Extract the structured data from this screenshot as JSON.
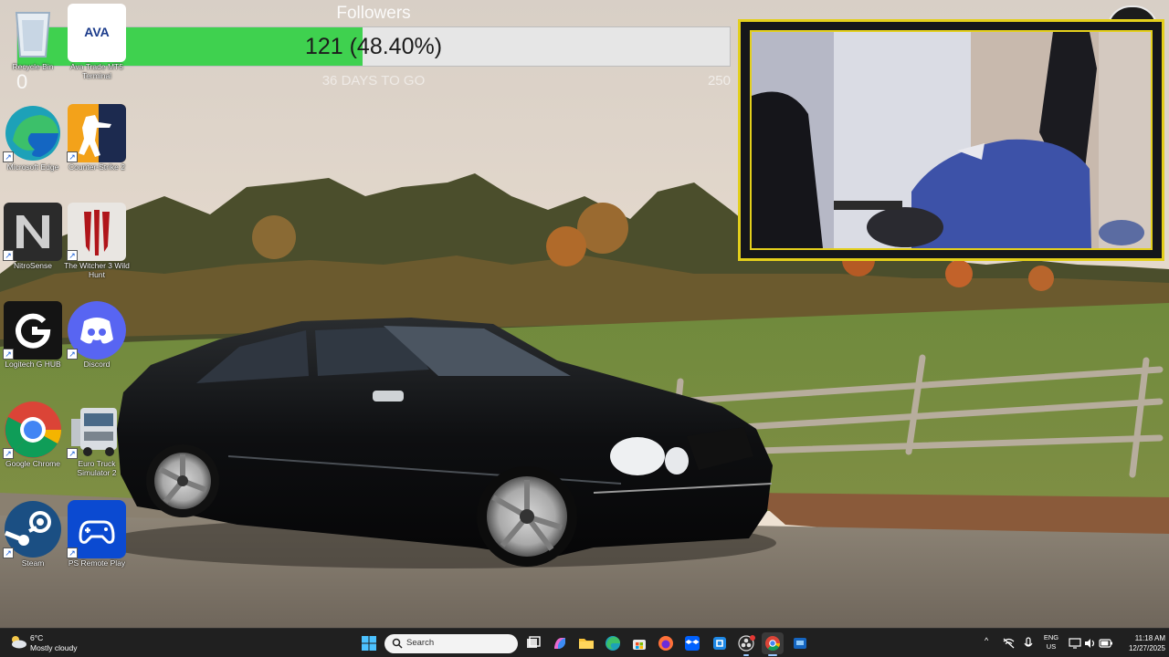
{
  "goal_widget": {
    "title": "Followers",
    "progress_text": "121 (48.40%)",
    "progress_fraction": 0.484,
    "min_label": "0",
    "days_left": "36 DAYS TO GO",
    "max_label": "250"
  },
  "desktop_icons": [
    {
      "label": "Recycle Bin",
      "icon": "recycle-bin-icon"
    },
    {
      "label": "Ava Trade MT5 Terminal",
      "icon": "ava-trade-icon"
    },
    {
      "label": "Microsoft Edge",
      "icon": "edge-icon"
    },
    {
      "label": "Counter-Strike 2",
      "icon": "counter-strike-icon"
    },
    {
      "label": "NitroSense",
      "icon": "nitrosense-icon"
    },
    {
      "label": "The Witcher 3 Wild Hunt",
      "icon": "witcher-icon"
    },
    {
      "label": "Logitech G HUB",
      "icon": "logitech-icon"
    },
    {
      "label": "Discord",
      "icon": "discord-icon"
    },
    {
      "label": "Google Chrome",
      "icon": "chrome-icon"
    },
    {
      "label": "Euro Truck Simulator 2",
      "icon": "truck-icon"
    },
    {
      "label": "Steam",
      "icon": "steam-icon"
    },
    {
      "label": "PS Remote Play",
      "icon": "ps-remote-play-icon"
    }
  ],
  "taskbar": {
    "weather": {
      "temp": "6°C",
      "condition": "Mostly cloudy"
    },
    "search_placeholder": "Search",
    "language": {
      "lang": "ENG",
      "region": "US"
    },
    "clock": {
      "time": "11:18 AM",
      "date": "12/27/2025"
    },
    "pinned": [
      "start-icon",
      "task-view-icon",
      "copilot-icon",
      "file-explorer-icon",
      "edge-icon",
      "store-icon",
      "firefox-icon",
      "dropbox-icon",
      "app-icon",
      "obs-icon",
      "chrome-icon",
      "app-icon"
    ]
  }
}
